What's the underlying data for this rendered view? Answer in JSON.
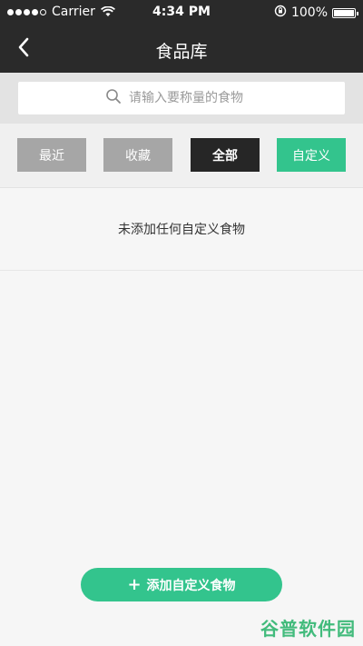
{
  "status_bar": {
    "carrier": "Carrier",
    "time": "4:34 PM",
    "battery": "100%",
    "icons": [
      "signal-icon",
      "wifi-icon",
      "orientation-lock-icon",
      "battery-icon"
    ]
  },
  "nav": {
    "title": "食品库",
    "back_icon": "chevron-left-icon"
  },
  "search": {
    "placeholder": "请输入要称量的食物",
    "value": "",
    "icon": "search-icon"
  },
  "tabs": [
    {
      "label": "最近",
      "state": "inactive"
    },
    {
      "label": "收藏",
      "state": "inactive"
    },
    {
      "label": "全部",
      "state": "active"
    },
    {
      "label": "自定义",
      "state": "highlight"
    }
  ],
  "empty_state": {
    "message": "未添加任何自定义食物"
  },
  "add_button": {
    "label": "添加自定义食物",
    "icon": "plus-icon"
  },
  "watermark": {
    "text": "谷普软件园"
  },
  "colors": {
    "nav_background": "#2a2a2a",
    "accent_green": "#33c48d",
    "tab_inactive": "#a6a6a6",
    "tab_active": "#262626",
    "page_background": "#f6f6f6"
  }
}
